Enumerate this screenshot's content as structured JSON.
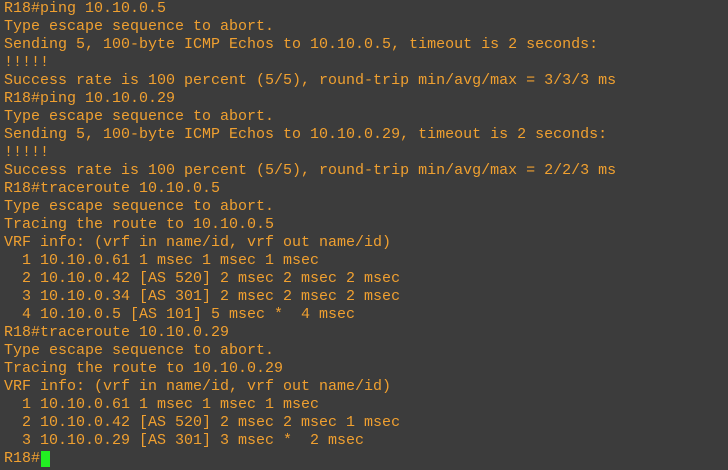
{
  "terminal": {
    "lines": [
      "R18#ping 10.10.0.5",
      "Type escape sequence to abort.",
      "Sending 5, 100-byte ICMP Echos to 10.10.0.5, timeout is 2 seconds:",
      "!!!!!",
      "Success rate is 100 percent (5/5), round-trip min/avg/max = 3/3/3 ms",
      "R18#ping 10.10.0.29",
      "Type escape sequence to abort.",
      "Sending 5, 100-byte ICMP Echos to 10.10.0.29, timeout is 2 seconds:",
      "!!!!!",
      "Success rate is 100 percent (5/5), round-trip min/avg/max = 2/2/3 ms",
      "R18#traceroute 10.10.0.5",
      "Type escape sequence to abort.",
      "Tracing the route to 10.10.0.5",
      "VRF info: (vrf in name/id, vrf out name/id)",
      "  1 10.10.0.61 1 msec 1 msec 1 msec",
      "  2 10.10.0.42 [AS 520] 2 msec 2 msec 2 msec",
      "  3 10.10.0.34 [AS 301] 2 msec 2 msec 2 msec",
      "  4 10.10.0.5 [AS 101] 5 msec *  4 msec",
      "R18#traceroute 10.10.0.29",
      "Type escape sequence to abort.",
      "Tracing the route to 10.10.0.29",
      "VRF info: (vrf in name/id, vrf out name/id)",
      "  1 10.10.0.61 1 msec 1 msec 1 msec",
      "  2 10.10.0.42 [AS 520] 2 msec 2 msec 1 msec",
      "  3 10.10.0.29 [AS 301] 3 msec *  2 msec"
    ],
    "prompt": "R18#",
    "colors": {
      "background": "#3c3c3c",
      "text": "#f0a030",
      "cursor": "#22ee22"
    }
  }
}
